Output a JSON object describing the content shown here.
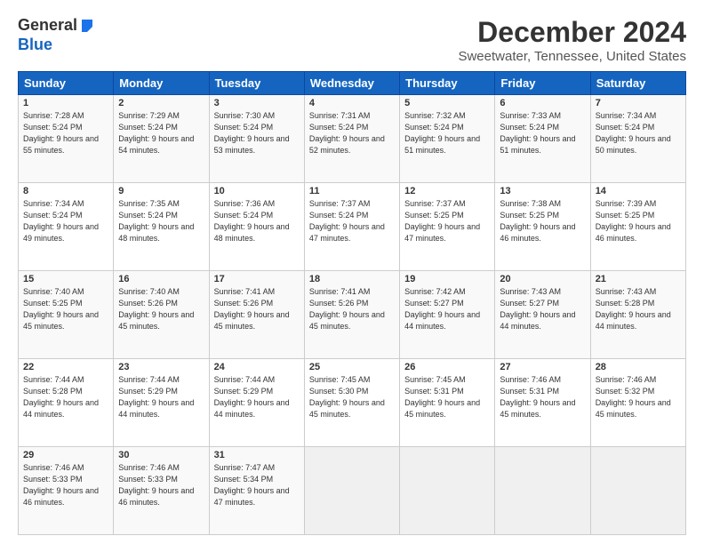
{
  "logo": {
    "general": "General",
    "blue": "Blue"
  },
  "title": "December 2024",
  "subtitle": "Sweetwater, Tennessee, United States",
  "days_header": [
    "Sunday",
    "Monday",
    "Tuesday",
    "Wednesday",
    "Thursday",
    "Friday",
    "Saturday"
  ],
  "weeks": [
    [
      {
        "day": "1",
        "sunrise": "Sunrise: 7:28 AM",
        "sunset": "Sunset: 5:24 PM",
        "daylight": "Daylight: 9 hours and 55 minutes."
      },
      {
        "day": "2",
        "sunrise": "Sunrise: 7:29 AM",
        "sunset": "Sunset: 5:24 PM",
        "daylight": "Daylight: 9 hours and 54 minutes."
      },
      {
        "day": "3",
        "sunrise": "Sunrise: 7:30 AM",
        "sunset": "Sunset: 5:24 PM",
        "daylight": "Daylight: 9 hours and 53 minutes."
      },
      {
        "day": "4",
        "sunrise": "Sunrise: 7:31 AM",
        "sunset": "Sunset: 5:24 PM",
        "daylight": "Daylight: 9 hours and 52 minutes."
      },
      {
        "day": "5",
        "sunrise": "Sunrise: 7:32 AM",
        "sunset": "Sunset: 5:24 PM",
        "daylight": "Daylight: 9 hours and 51 minutes."
      },
      {
        "day": "6",
        "sunrise": "Sunrise: 7:33 AM",
        "sunset": "Sunset: 5:24 PM",
        "daylight": "Daylight: 9 hours and 51 minutes."
      },
      {
        "day": "7",
        "sunrise": "Sunrise: 7:34 AM",
        "sunset": "Sunset: 5:24 PM",
        "daylight": "Daylight: 9 hours and 50 minutes."
      }
    ],
    [
      {
        "day": "8",
        "sunrise": "Sunrise: 7:34 AM",
        "sunset": "Sunset: 5:24 PM",
        "daylight": "Daylight: 9 hours and 49 minutes."
      },
      {
        "day": "9",
        "sunrise": "Sunrise: 7:35 AM",
        "sunset": "Sunset: 5:24 PM",
        "daylight": "Daylight: 9 hours and 48 minutes."
      },
      {
        "day": "10",
        "sunrise": "Sunrise: 7:36 AM",
        "sunset": "Sunset: 5:24 PM",
        "daylight": "Daylight: 9 hours and 48 minutes."
      },
      {
        "day": "11",
        "sunrise": "Sunrise: 7:37 AM",
        "sunset": "Sunset: 5:24 PM",
        "daylight": "Daylight: 9 hours and 47 minutes."
      },
      {
        "day": "12",
        "sunrise": "Sunrise: 7:37 AM",
        "sunset": "Sunset: 5:25 PM",
        "daylight": "Daylight: 9 hours and 47 minutes."
      },
      {
        "day": "13",
        "sunrise": "Sunrise: 7:38 AM",
        "sunset": "Sunset: 5:25 PM",
        "daylight": "Daylight: 9 hours and 46 minutes."
      },
      {
        "day": "14",
        "sunrise": "Sunrise: 7:39 AM",
        "sunset": "Sunset: 5:25 PM",
        "daylight": "Daylight: 9 hours and 46 minutes."
      }
    ],
    [
      {
        "day": "15",
        "sunrise": "Sunrise: 7:40 AM",
        "sunset": "Sunset: 5:25 PM",
        "daylight": "Daylight: 9 hours and 45 minutes."
      },
      {
        "day": "16",
        "sunrise": "Sunrise: 7:40 AM",
        "sunset": "Sunset: 5:26 PM",
        "daylight": "Daylight: 9 hours and 45 minutes."
      },
      {
        "day": "17",
        "sunrise": "Sunrise: 7:41 AM",
        "sunset": "Sunset: 5:26 PM",
        "daylight": "Daylight: 9 hours and 45 minutes."
      },
      {
        "day": "18",
        "sunrise": "Sunrise: 7:41 AM",
        "sunset": "Sunset: 5:26 PM",
        "daylight": "Daylight: 9 hours and 45 minutes."
      },
      {
        "day": "19",
        "sunrise": "Sunrise: 7:42 AM",
        "sunset": "Sunset: 5:27 PM",
        "daylight": "Daylight: 9 hours and 44 minutes."
      },
      {
        "day": "20",
        "sunrise": "Sunrise: 7:43 AM",
        "sunset": "Sunset: 5:27 PM",
        "daylight": "Daylight: 9 hours and 44 minutes."
      },
      {
        "day": "21",
        "sunrise": "Sunrise: 7:43 AM",
        "sunset": "Sunset: 5:28 PM",
        "daylight": "Daylight: 9 hours and 44 minutes."
      }
    ],
    [
      {
        "day": "22",
        "sunrise": "Sunrise: 7:44 AM",
        "sunset": "Sunset: 5:28 PM",
        "daylight": "Daylight: 9 hours and 44 minutes."
      },
      {
        "day": "23",
        "sunrise": "Sunrise: 7:44 AM",
        "sunset": "Sunset: 5:29 PM",
        "daylight": "Daylight: 9 hours and 44 minutes."
      },
      {
        "day": "24",
        "sunrise": "Sunrise: 7:44 AM",
        "sunset": "Sunset: 5:29 PM",
        "daylight": "Daylight: 9 hours and 44 minutes."
      },
      {
        "day": "25",
        "sunrise": "Sunrise: 7:45 AM",
        "sunset": "Sunset: 5:30 PM",
        "daylight": "Daylight: 9 hours and 45 minutes."
      },
      {
        "day": "26",
        "sunrise": "Sunrise: 7:45 AM",
        "sunset": "Sunset: 5:31 PM",
        "daylight": "Daylight: 9 hours and 45 minutes."
      },
      {
        "day": "27",
        "sunrise": "Sunrise: 7:46 AM",
        "sunset": "Sunset: 5:31 PM",
        "daylight": "Daylight: 9 hours and 45 minutes."
      },
      {
        "day": "28",
        "sunrise": "Sunrise: 7:46 AM",
        "sunset": "Sunset: 5:32 PM",
        "daylight": "Daylight: 9 hours and 45 minutes."
      }
    ],
    [
      {
        "day": "29",
        "sunrise": "Sunrise: 7:46 AM",
        "sunset": "Sunset: 5:33 PM",
        "daylight": "Daylight: 9 hours and 46 minutes."
      },
      {
        "day": "30",
        "sunrise": "Sunrise: 7:46 AM",
        "sunset": "Sunset: 5:33 PM",
        "daylight": "Daylight: 9 hours and 46 minutes."
      },
      {
        "day": "31",
        "sunrise": "Sunrise: 7:47 AM",
        "sunset": "Sunset: 5:34 PM",
        "daylight": "Daylight: 9 hours and 47 minutes."
      },
      null,
      null,
      null,
      null
    ]
  ]
}
